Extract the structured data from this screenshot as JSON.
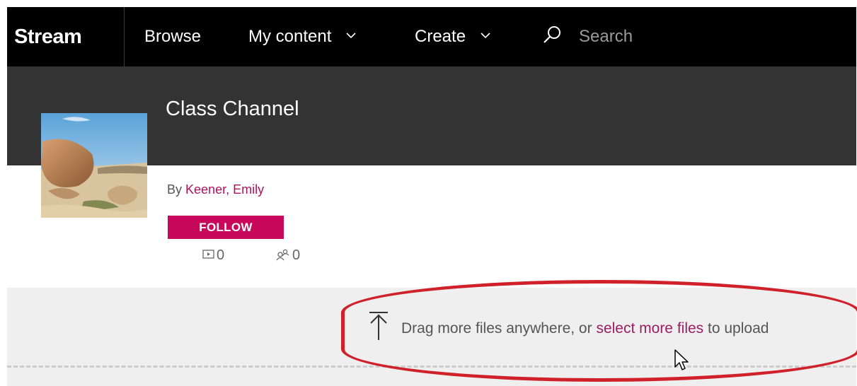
{
  "nav": {
    "brand": "Stream",
    "browse": "Browse",
    "my_content": "My content",
    "create": "Create",
    "search_placeholder": "Search"
  },
  "channel": {
    "title": "Class Channel",
    "by_prefix": "By",
    "owner": "Keener, Emily",
    "follow_label": "FOLLOW",
    "video_count": "0",
    "follower_count": "0"
  },
  "upload": {
    "text_before": "Drag more files anywhere, or",
    "link_text": "select more files",
    "text_after": "to upload"
  },
  "icons": {
    "search": "search-icon",
    "chevron": "chevron-down-icon",
    "video": "video-icon",
    "followers": "followers-icon",
    "upload": "upload-icon",
    "cursor": "mouse-pointer-icon"
  },
  "colors": {
    "nav_bg": "#000000",
    "header_bg": "#333333",
    "accent": "#c8095b",
    "link": "#b0125c",
    "highlight": "#d0202a"
  }
}
